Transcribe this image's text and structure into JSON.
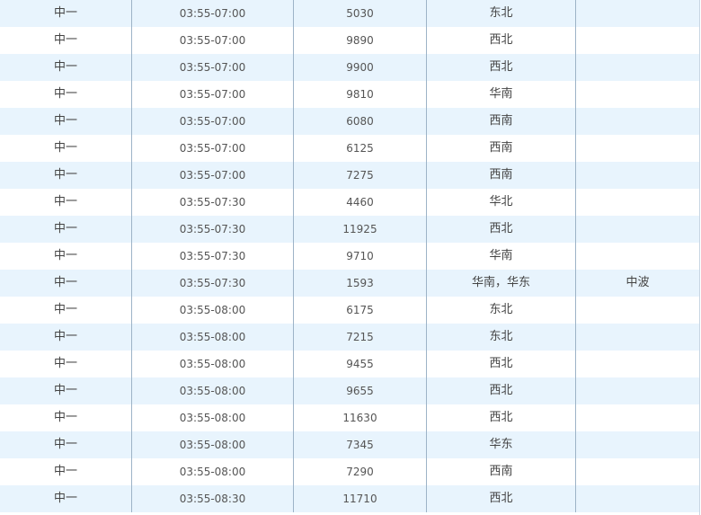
{
  "rows": [
    {
      "day": "中一",
      "time": "03:55-07:00",
      "freq": "5030",
      "area": "东北",
      "note": ""
    },
    {
      "day": "中一",
      "time": "03:55-07:00",
      "freq": "9890",
      "area": "西北",
      "note": ""
    },
    {
      "day": "中一",
      "time": "03:55-07:00",
      "freq": "9900",
      "area": "西北",
      "note": ""
    },
    {
      "day": "中一",
      "time": "03:55-07:00",
      "freq": "9810",
      "area": "华南",
      "note": ""
    },
    {
      "day": "中一",
      "time": "03:55-07:00",
      "freq": "6080",
      "area": "西南",
      "note": ""
    },
    {
      "day": "中一",
      "time": "03:55-07:00",
      "freq": "6125",
      "area": "西南",
      "note": ""
    },
    {
      "day": "中一",
      "time": "03:55-07:00",
      "freq": "7275",
      "area": "西南",
      "note": ""
    },
    {
      "day": "中一",
      "time": "03:55-07:30",
      "freq": "4460",
      "area": "华北",
      "note": ""
    },
    {
      "day": "中一",
      "time": "03:55-07:30",
      "freq": "11925",
      "area": "西北",
      "note": ""
    },
    {
      "day": "中一",
      "time": "03:55-07:30",
      "freq": "9710",
      "area": "华南",
      "note": ""
    },
    {
      "day": "中一",
      "time": "03:55-07:30",
      "freq": "1593",
      "area": "华南，华东",
      "note": "中波"
    },
    {
      "day": "中一",
      "time": "03:55-08:00",
      "freq": "6175",
      "area": "东北",
      "note": ""
    },
    {
      "day": "中一",
      "time": "03:55-08:00",
      "freq": "7215",
      "area": "东北",
      "note": ""
    },
    {
      "day": "中一",
      "time": "03:55-08:00",
      "freq": "9455",
      "area": "西北",
      "note": ""
    },
    {
      "day": "中一",
      "time": "03:55-08:00",
      "freq": "9655",
      "area": "西北",
      "note": ""
    },
    {
      "day": "中一",
      "time": "03:55-08:00",
      "freq": "11630",
      "area": "西北",
      "note": ""
    },
    {
      "day": "中一",
      "time": "03:55-08:00",
      "freq": "7345",
      "area": "华东",
      "note": ""
    },
    {
      "day": "中一",
      "time": "03:55-08:00",
      "freq": "7290",
      "area": "西南",
      "note": ""
    },
    {
      "day": "中一",
      "time": "03:55-08:30",
      "freq": "11710",
      "area": "西北",
      "note": ""
    }
  ]
}
